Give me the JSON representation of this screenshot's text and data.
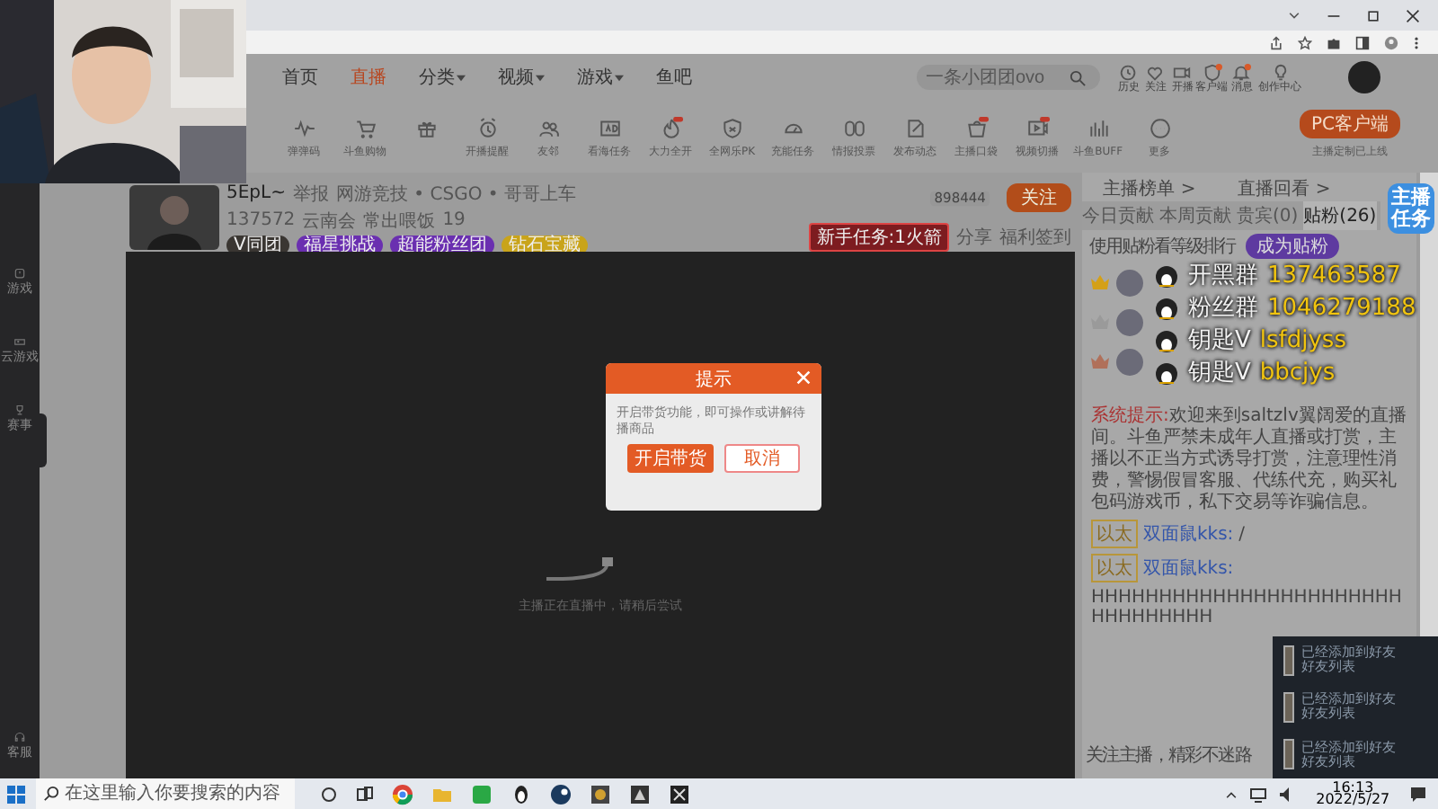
{
  "sidebar": {
    "items": [
      {
        "label": "游戏"
      },
      {
        "label": "云游戏"
      },
      {
        "label": "赛事"
      }
    ],
    "bottom": {
      "label": "客服"
    }
  },
  "nav": {
    "items": [
      {
        "label": "首页",
        "selected": false,
        "dropdown": false
      },
      {
        "label": "直播",
        "selected": true,
        "dropdown": false
      },
      {
        "label": "分类",
        "selected": false,
        "dropdown": true
      },
      {
        "label": "视频",
        "selected": false,
        "dropdown": true
      },
      {
        "label": "游戏",
        "selected": false,
        "dropdown": true
      },
      {
        "label": "鱼吧",
        "selected": false,
        "dropdown": false
      }
    ],
    "search": {
      "placeholder": "一条小团团ovo"
    },
    "actions": [
      {
        "label": "历史",
        "badge": false
      },
      {
        "label": "关注",
        "badge": false
      },
      {
        "label": "开播",
        "badge": false
      },
      {
        "label": "客户端",
        "badge": true
      },
      {
        "label": "消息",
        "badge": true
      },
      {
        "label": "创作中心",
        "badge": false
      }
    ]
  },
  "toolbar": {
    "items": [
      {
        "label": "弹弹码",
        "new": false
      },
      {
        "label": "斗鱼购物",
        "new": false
      },
      {
        "new": false
      },
      {
        "label": "开播提醒",
        "new": false
      },
      {
        "label": "友邻",
        "new": false
      },
      {
        "label": "看海任务",
        "new": false
      },
      {
        "label": "大力全开",
        "new": true
      },
      {
        "label": "全网乐PK",
        "new": false
      },
      {
        "label": "充能任务",
        "new": false
      },
      {
        "label": "情报投票",
        "new": false
      },
      {
        "label": "发布动态",
        "new": false
      },
      {
        "label": "主播口袋",
        "new": true
      },
      {
        "label": "视频切播",
        "new": true
      },
      {
        "label": "斗鱼BUFF",
        "new": false
      },
      {
        "label": "更多",
        "new": false
      }
    ],
    "client_button": "PC客户端",
    "client_caption": "主播定制已上线"
  },
  "streamer": {
    "name": "5EpL~",
    "report": "举报",
    "category": "网游竞技 • CSGO • 哥哥上车",
    "heat": "137572",
    "city": "云南会",
    "tag": "常出喂饭",
    "tag_count": "19",
    "room_id": "898444",
    "follow": "关注",
    "chips": [
      {
        "label": "V同团",
        "color": "#3a3632"
      },
      {
        "label": "福星挑战",
        "color": "#6a2fb0"
      },
      {
        "label": "超能粉丝团",
        "color": "#6a2fb0"
      },
      {
        "label": "钻石宝藏",
        "color": "#c9a41a"
      }
    ],
    "task": "新手任务:1火箭",
    "links": [
      "分享",
      "福利签到"
    ]
  },
  "video": {
    "status": "主播正在直播中，请稍后尝试"
  },
  "modal": {
    "title": "提示",
    "body": "开启带货功能，即可操作或讲解待播商品",
    "confirm": "开启带货",
    "cancel": "取消"
  },
  "right_panel": {
    "links": [
      "主播榜单 >",
      "直播回看 >"
    ],
    "tabs": [
      {
        "label": "今日贡献",
        "selected": false
      },
      {
        "label": "本周贡献",
        "selected": false
      },
      {
        "label": "贵宾(0)",
        "selected": false
      },
      {
        "label": "贴粉(26)",
        "selected": true
      }
    ],
    "prompt": "使用贴粉看等级排行",
    "become_button": "成为贴粉",
    "ranks": [
      {
        "color": "#d4a017"
      },
      {
        "color": "#9a9a9a"
      },
      {
        "color": "#b0705a"
      }
    ],
    "system_label": "系统提示:",
    "system_text": "欢迎来到saltzlv翼阔爱的直播间。斗鱼严禁未成年人直播或打赏，主播以不正当方式诱导打赏，注意理性消费，警惕假冒客服、代练代充，购买礼包码游戏币，私下交易等诈骗信息。",
    "messages": [
      {
        "badge": "以太",
        "user": "双面鼠kks:",
        "text": "/"
      },
      {
        "badge": "以太",
        "user": "双面鼠kks:",
        "text": "HHHHHHHHHHHHHHHHHHHHHHHHHHHHHHHH"
      }
    ],
    "footer": "关注主播，精彩不迷路"
  },
  "stream_overlay": {
    "badge": "主播任务",
    "lines": [
      {
        "label": "开黑群",
        "value": "137463587"
      },
      {
        "label": "粉丝群",
        "value": "1046279188"
      },
      {
        "label": "钥匙V",
        "value": "lsfdjyss"
      },
      {
        "label": "钥匙V",
        "value": "bbcjys"
      }
    ]
  },
  "notifications": [
    {
      "line": "已经添加到好友",
      "action": "好友列表"
    },
    {
      "line": "已经添加到好友",
      "action": "好友列表"
    },
    {
      "line": "已经添加到好友",
      "action": "好友列表"
    }
  ],
  "taskbar": {
    "search": {
      "placeholder": "在这里输入你要搜索的内容"
    },
    "time": "16:13",
    "date": "2022/5/27"
  }
}
